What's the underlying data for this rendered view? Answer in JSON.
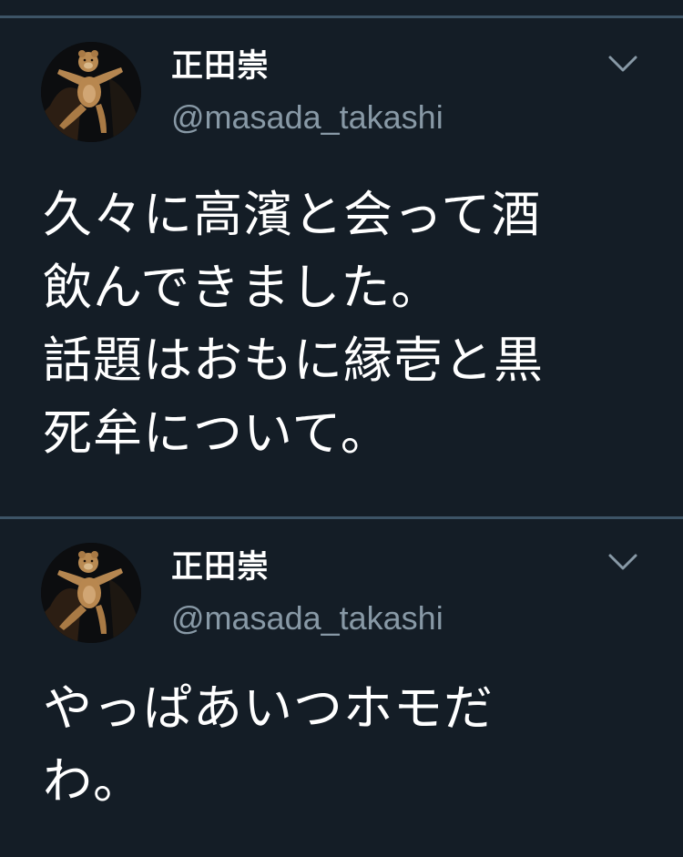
{
  "colors": {
    "background": "#141d26",
    "divider": "#3d5466",
    "text_primary": "#ffffff",
    "text_secondary": "#8899a6"
  },
  "tweets": [
    {
      "display_name": "正田崇",
      "handle": "@masada_takashi",
      "avatar_icon": "bear-avatar-icon",
      "menu_icon": "chevron-down-icon",
      "lines": [
        "久々に高濱と会って酒",
        "飲んできました。",
        "話題はおもに縁壱と黒",
        "死牟について。"
      ]
    },
    {
      "display_name": "正田崇",
      "handle": "@masada_takashi",
      "avatar_icon": "bear-avatar-icon",
      "menu_icon": "chevron-down-icon",
      "lines": [
        "やっぱあいつホモだ",
        "わ。"
      ]
    }
  ]
}
